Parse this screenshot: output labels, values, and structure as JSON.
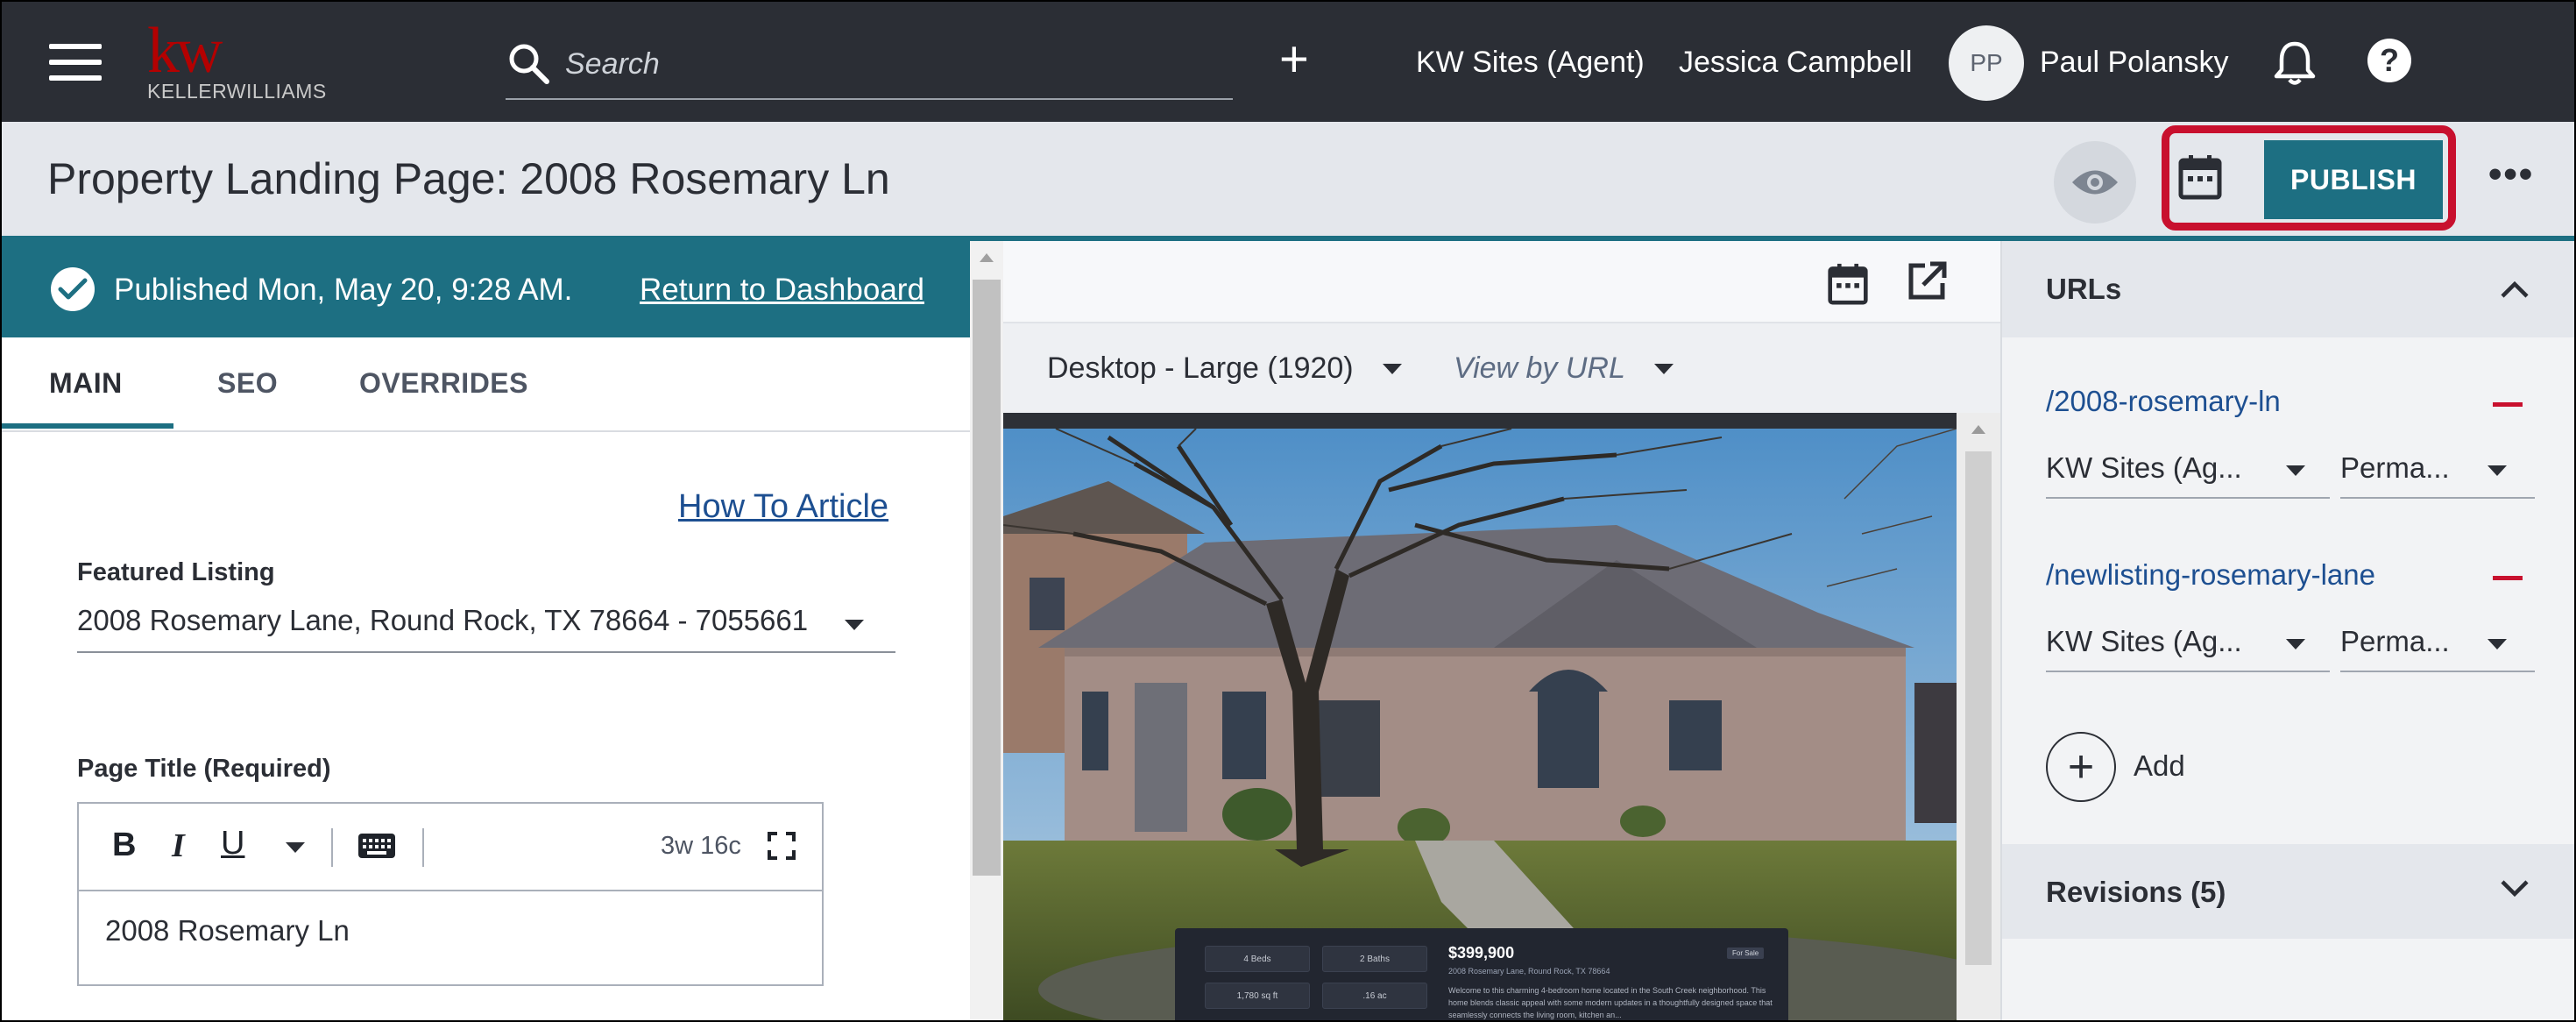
{
  "topnav": {
    "logo_mark": "kw",
    "logo_text": "KELLERWILLIAMS",
    "search_placeholder": "Search",
    "add_icon": "plus-icon",
    "site_label": "KW Sites (Agent)",
    "agent_name": "Jessica Campbell",
    "user_initials": "PP",
    "user_name": "Paul Polansky",
    "help_label": "?"
  },
  "header": {
    "title": "Property Landing Page: 2008 Rosemary Ln",
    "publish_label": "PUBLISH",
    "more_label": "•••",
    "highlight_color": "#c8102e"
  },
  "banner": {
    "status": "Published Mon, May 20, 9:28 AM.",
    "return_link": "Return to Dashboard"
  },
  "tabs": [
    {
      "label": "MAIN",
      "active": true
    },
    {
      "label": "SEO",
      "active": false
    },
    {
      "label": "OVERRIDES",
      "active": false
    }
  ],
  "form": {
    "howto_link": "How To Article",
    "featured_label": "Featured Listing",
    "featured_value": "2008 Rosemary Lane, Round Rock, TX 78664 - 7055661",
    "page_title_label": "Page Title (Required)",
    "editor_count": "3w 16c",
    "editor_value": "2008 Rosemary Ln",
    "toolbar": {
      "bold": "B",
      "italic": "I",
      "underline": "U"
    }
  },
  "preview": {
    "device": "Desktop - Large (1920)",
    "view_by": "View by URL",
    "listing": {
      "beds": "4 Beds",
      "baths": "2 Baths",
      "sqft": "1,780 sq ft",
      "acres": ".16 ac",
      "price": "$399,900",
      "address": "2008 Rosemary Lane, Round Rock, TX 78664",
      "badge": "For Sale",
      "description": "Welcome to this charming 4-bedroom home located in the South Creek neighborhood. This home blends classic appeal with some modern updates in a thoughtfully designed space that seamlessly connects the living room, kitchen an..."
    }
  },
  "urls": {
    "title": "URLs",
    "items": [
      {
        "path": "/2008-rosemary-ln",
        "site": "KW Sites (Ag...",
        "type": "Perma..."
      },
      {
        "path": "/newlisting-rosemary-lane",
        "site": "KW Sites (Ag...",
        "type": "Perma..."
      }
    ],
    "add_label": "Add"
  },
  "revisions": {
    "title": "Revisions (5)"
  },
  "colors": {
    "nav_bg": "#2b2e35",
    "accent_teal": "#1d6f82",
    "link_blue": "#1d4f91",
    "brand_red": "#b40101"
  }
}
